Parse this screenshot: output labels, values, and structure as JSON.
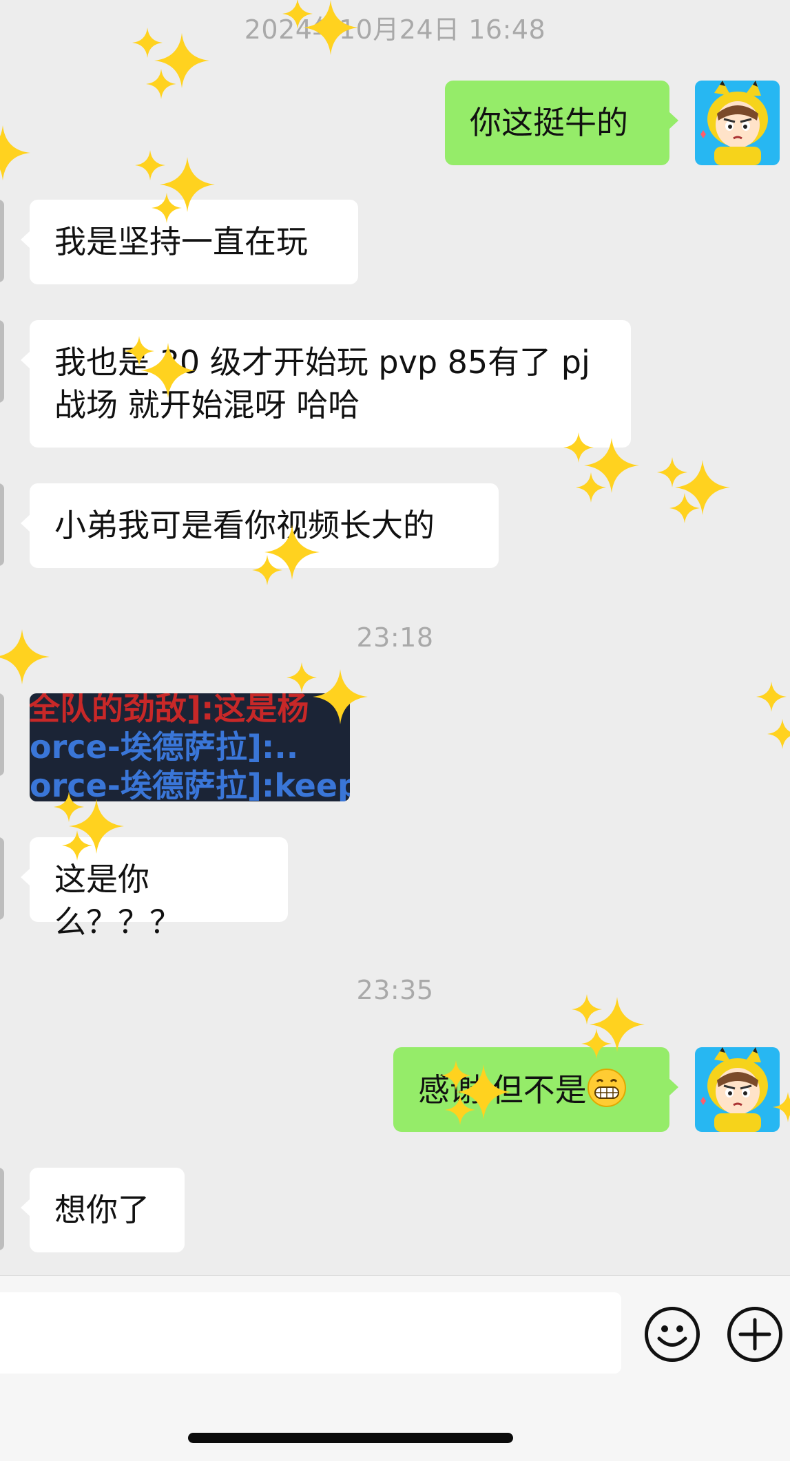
{
  "timestamps": [
    "2024年10月24日 16:48",
    "23:18",
    "23:35"
  ],
  "messages": [
    {
      "side": "out",
      "text": "你这挺牛的"
    },
    {
      "side": "in",
      "text": "我是坚持一直在玩"
    },
    {
      "side": "in",
      "text": "我也是 30 级才开始玩 pvp 85有了 pj\n战场 就开始混呀 哈哈"
    },
    {
      "side": "in",
      "text": "小弟我可是看你视频长大的"
    },
    {
      "side": "in",
      "type": "image",
      "lines": [
        "全队的劲敌]:这是杨",
        "orce-埃德萨拉]:..",
        "orce-埃德萨拉]:keep"
      ]
    },
    {
      "side": "in",
      "text": "这是你么？？？"
    },
    {
      "side": "out",
      "text": "感谢 但不是",
      "emoji": "grin-emoji"
    },
    {
      "side": "in",
      "text": "想你了"
    }
  ],
  "input": {
    "placeholder": "",
    "value": ""
  },
  "icons": {
    "emoji_button": "smiley-icon",
    "more_button": "plus-icon"
  },
  "colors": {
    "background": "#ededed",
    "outgoing": "#95ec69",
    "incoming": "#ffffff",
    "timestamp": "#a9a9a9"
  }
}
